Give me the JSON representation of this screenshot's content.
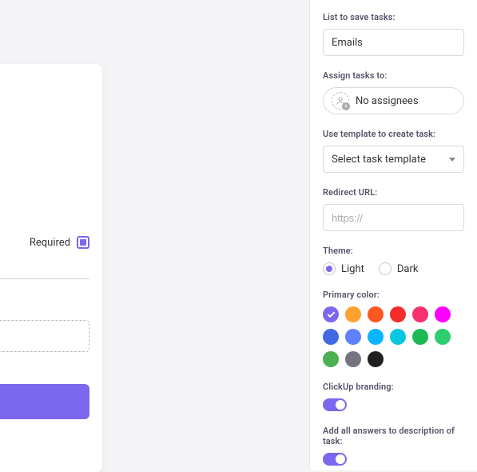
{
  "left": {
    "required_label": "Required"
  },
  "sidebar": {
    "list_label": "List to save tasks:",
    "list_value": "Emails",
    "assign_label": "Assign tasks to:",
    "assign_value": "No assignees",
    "template_label": "Use template to create task:",
    "template_value": "Select task template",
    "redirect_label": "Redirect URL:",
    "redirect_placeholder": "https://",
    "theme_label": "Theme:",
    "theme_options": {
      "light": "Light",
      "dark": "Dark"
    },
    "primary_color_label": "Primary color:",
    "colors": [
      "#7b68ee",
      "#ffa12f",
      "#ff5722",
      "#f42c2c",
      "#f8306d",
      "#ff00ff",
      "#4169e1",
      "#5f81ff",
      "#0ab4ff",
      "#08c7e0",
      "#1db954",
      "#2ecd6f",
      "#4caf50",
      "#757380",
      "#202020"
    ],
    "selected_color_index": 0,
    "branding_label": "ClickUp branding:",
    "answers_label": "Add all answers to description of task:"
  }
}
